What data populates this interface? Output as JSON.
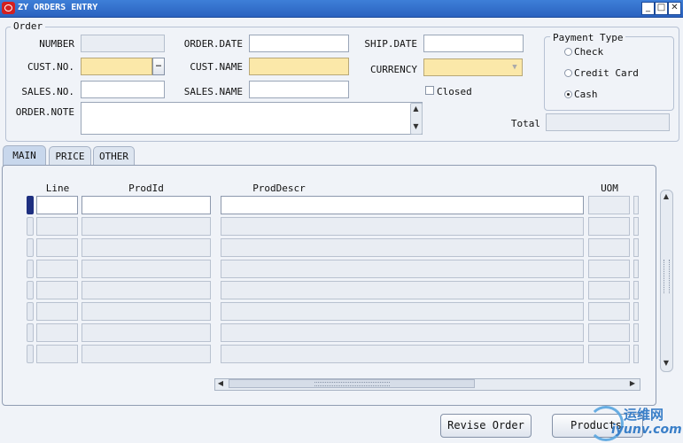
{
  "window": {
    "title": "ZY ORDERS ENTRY"
  },
  "order": {
    "group_label": "Order",
    "number_label": "NUMBER",
    "order_date_label": "ORDER.DATE",
    "ship_date_label": "SHIP.DATE",
    "cust_no_label": "CUST.NO.",
    "cust_name_label": "CUST.NAME",
    "currency_label": "CURRENCY",
    "sales_no_label": "SALES.NO.",
    "sales_name_label": "SALES.NAME",
    "order_note_label": "ORDER.NOTE",
    "closed_label": "Closed",
    "total_label": "Total"
  },
  "payment": {
    "group_label": "Payment Type",
    "options": [
      "Check",
      "Credit Card",
      "Cash"
    ],
    "selected": "Cash"
  },
  "tabs": [
    {
      "label": "MAIN",
      "active": true
    },
    {
      "label": "PRICE",
      "active": false
    },
    {
      "label": "OTHER",
      "active": false
    }
  ],
  "grid": {
    "columns": [
      "Line",
      "ProdId",
      "ProdDescr",
      "UOM"
    ]
  },
  "buttons": {
    "revise_order": "Revise Order",
    "products": "Products"
  },
  "watermark": {
    "brand": "运维网",
    "site": "iyunv.com"
  },
  "colors": {
    "titlebar": "#2b62bf",
    "required_field": "#fbe8a9",
    "current_row_indicator": "#1e2f80"
  }
}
